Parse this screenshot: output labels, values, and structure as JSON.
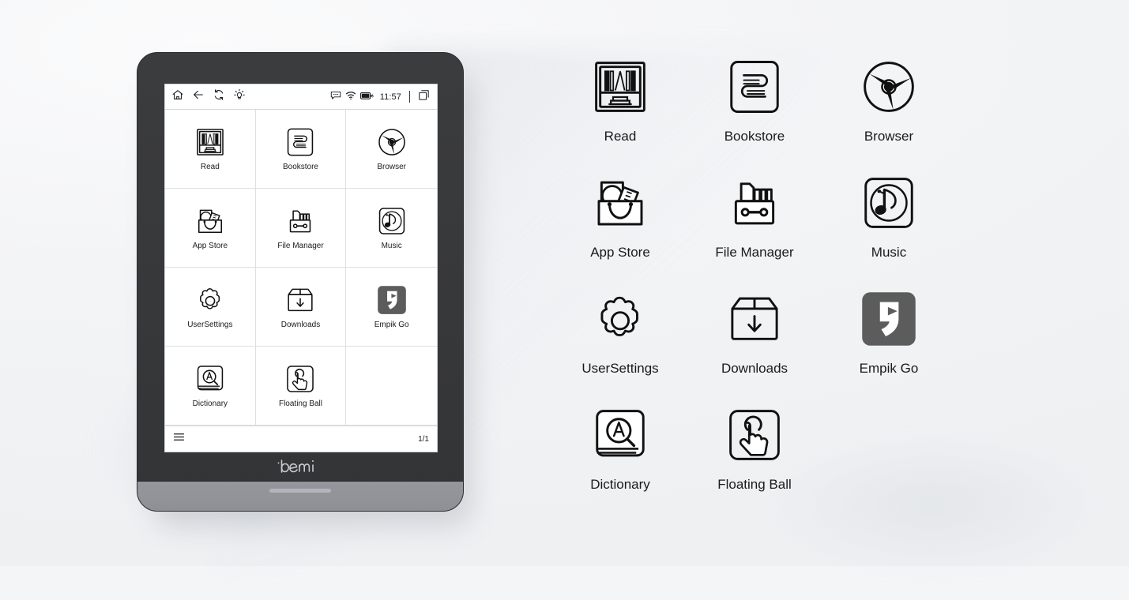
{
  "device": {
    "brand": "bemi",
    "statusbar": {
      "left_icons": [
        {
          "name": "home-icon",
          "label": "Home"
        },
        {
          "name": "back-arrow-icon",
          "label": "Back"
        },
        {
          "name": "refresh-icon",
          "label": "Refresh"
        },
        {
          "name": "brightness-icon",
          "label": "Brightness"
        }
      ],
      "right_icons": [
        {
          "name": "message-icon",
          "label": "Messages"
        },
        {
          "name": "wifi-icon",
          "label": "Wi-Fi"
        },
        {
          "name": "battery-charging-icon",
          "label": "Battery charging"
        }
      ],
      "time": "11:57",
      "tabs_icon": {
        "name": "tabs-icon",
        "label": "Recent tasks"
      }
    },
    "bottombar": {
      "menu_icon": {
        "name": "hamburger-menu-icon",
        "label": "Menu"
      },
      "page_indicator": "1/1"
    },
    "apps": [
      {
        "id": "read",
        "label": "Read",
        "icon": "bookshelf-icon"
      },
      {
        "id": "bookstore",
        "label": "Bookstore",
        "icon": "bookstore-icon"
      },
      {
        "id": "browser",
        "label": "Browser",
        "icon": "browser-icon"
      },
      {
        "id": "app-store",
        "label": "App Store",
        "icon": "app-store-bag-icon"
      },
      {
        "id": "file-manager",
        "label": "File Manager",
        "icon": "file-manager-icon"
      },
      {
        "id": "music",
        "label": "Music",
        "icon": "music-note-icon"
      },
      {
        "id": "user-settings",
        "label": "UserSettings",
        "icon": "gear-icon"
      },
      {
        "id": "downloads",
        "label": "Downloads",
        "icon": "download-box-icon"
      },
      {
        "id": "empik-go",
        "label": "Empik Go",
        "icon": "empik-go-icon"
      },
      {
        "id": "dictionary",
        "label": "Dictionary",
        "icon": "dictionary-icon"
      },
      {
        "id": "floating-ball",
        "label": "Floating Ball",
        "icon": "floating-ball-hand-icon"
      },
      {
        "id": "empty",
        "label": "",
        "icon": "none"
      }
    ]
  },
  "gallery": {
    "items": [
      {
        "id": "read",
        "label": "Read",
        "icon": "bookshelf-icon"
      },
      {
        "id": "bookstore",
        "label": "Bookstore",
        "icon": "bookstore-icon"
      },
      {
        "id": "browser",
        "label": "Browser",
        "icon": "browser-icon"
      },
      {
        "id": "app-store",
        "label": "App Store",
        "icon": "app-store-bag-icon"
      },
      {
        "id": "file-manager",
        "label": "File Manager",
        "icon": "file-manager-icon"
      },
      {
        "id": "music",
        "label": "Music",
        "icon": "music-note-icon"
      },
      {
        "id": "user-settings",
        "label": "UserSettings",
        "icon": "gear-icon"
      },
      {
        "id": "downloads",
        "label": "Downloads",
        "icon": "download-box-icon"
      },
      {
        "id": "empik-go",
        "label": "Empik Go",
        "icon": "empik-go-icon"
      },
      {
        "id": "dictionary",
        "label": "Dictionary",
        "icon": "dictionary-icon"
      },
      {
        "id": "floating-ball",
        "label": "Floating Ball",
        "icon": "floating-ball-hand-icon"
      }
    ]
  },
  "colors": {
    "background": "#f4f5f7",
    "device_body": "#37383a",
    "device_foot": "#92939a",
    "screen": "#ffffff",
    "icon_stroke": "#111111",
    "empik_tile": "#5c5c5c",
    "grid_line": "#dddfe1"
  }
}
